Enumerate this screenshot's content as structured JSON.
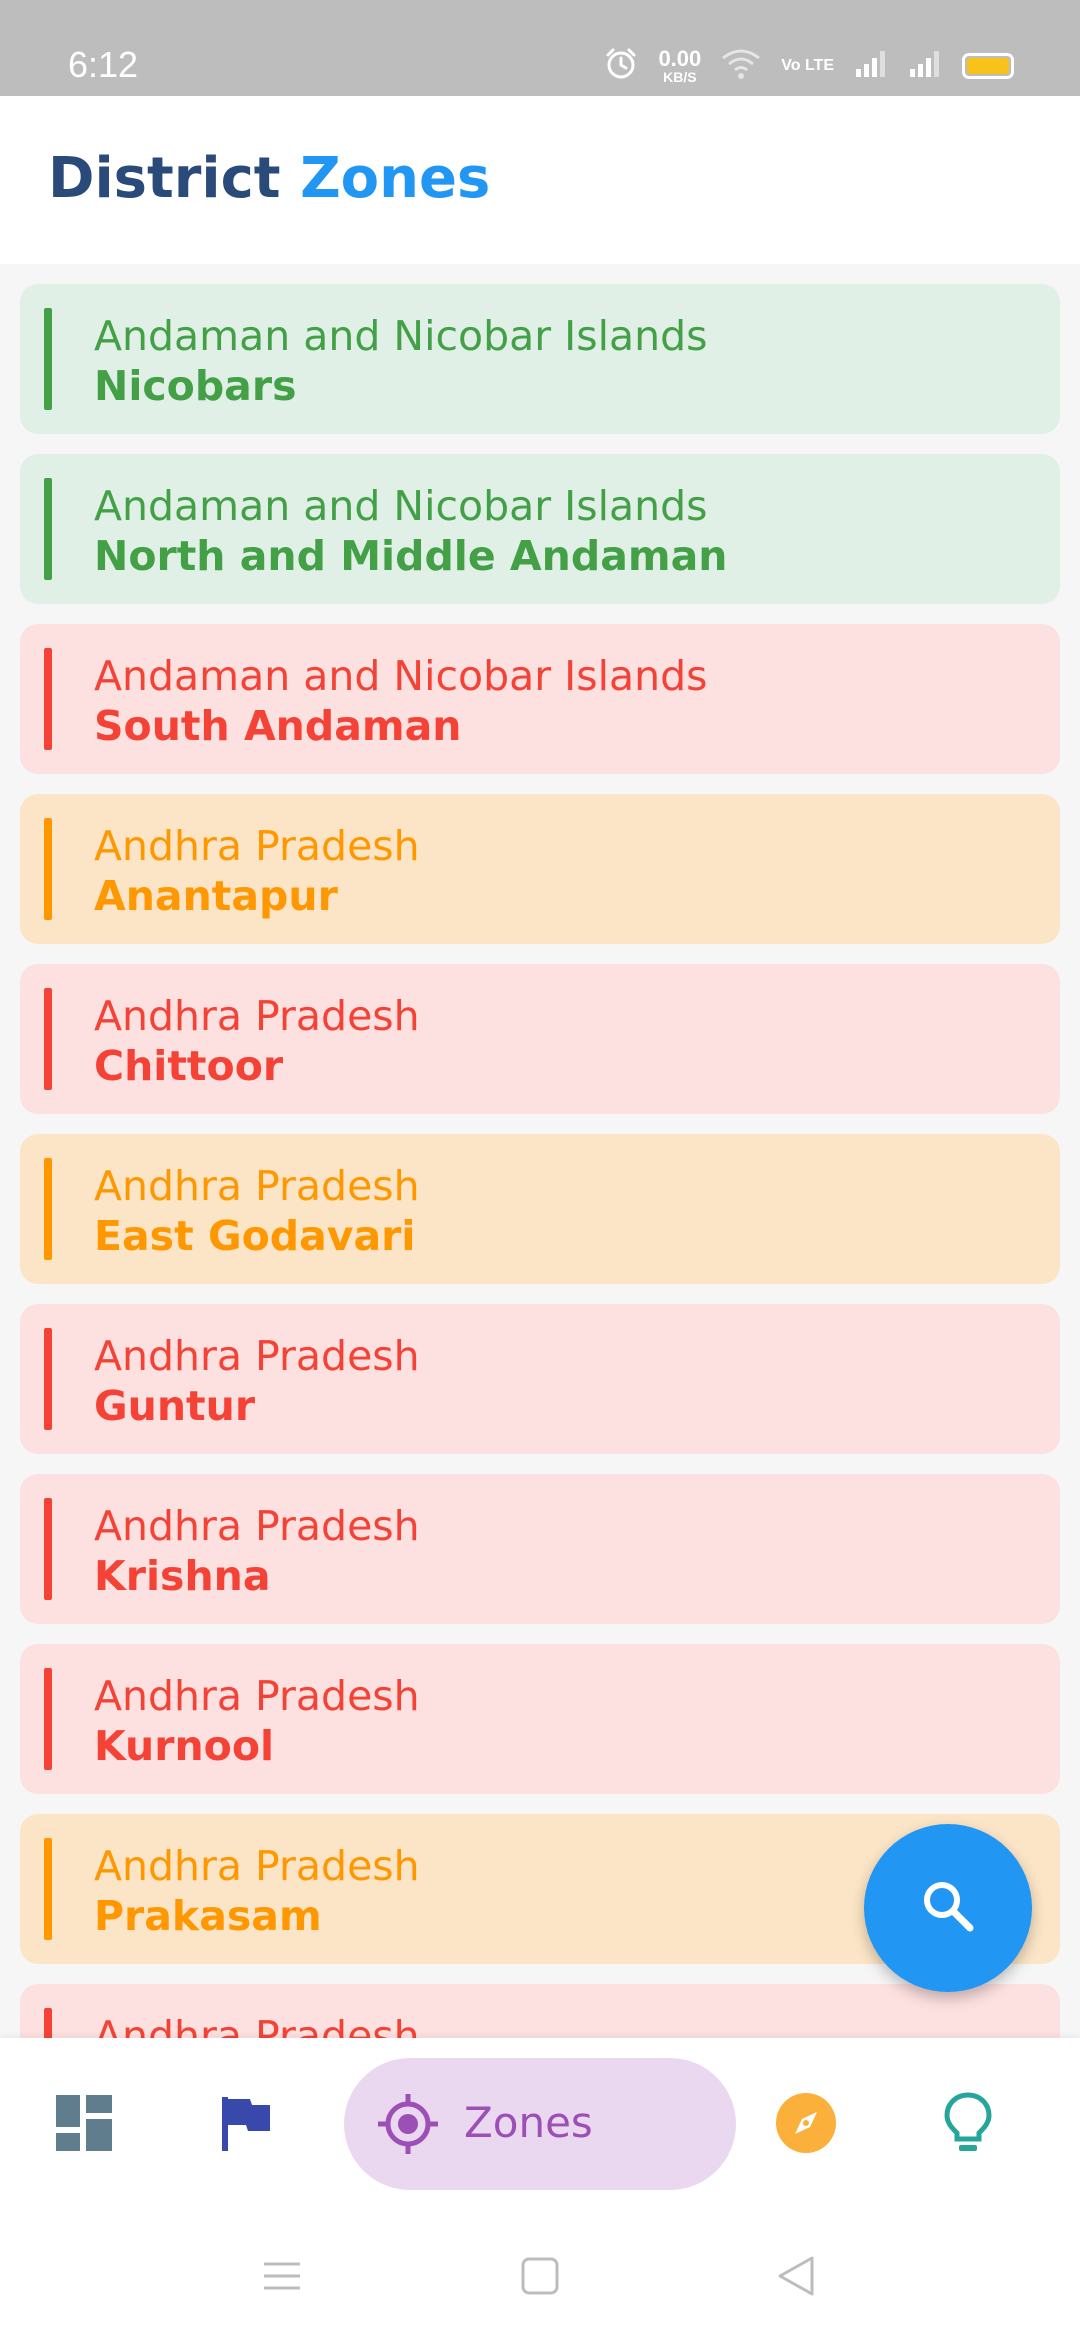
{
  "status_bar": {
    "time": "6:12",
    "net_speed_value": "0.00",
    "net_speed_unit": "KB/S",
    "volte_label": "Vo LTE",
    "icons": [
      "alarm-icon",
      "wifi-icon",
      "signal-icon",
      "signal-icon",
      "battery-icon"
    ],
    "battery_color": "#f7c31b"
  },
  "header": {
    "title_part1": "District",
    "title_part2": "Zones"
  },
  "colors": {
    "green_zone": "#43a047",
    "red_zone": "#f44336",
    "orange_zone": "#ff9800",
    "accent": "#2196f3"
  },
  "districts": [
    {
      "state": "Andaman and Nicobar Islands",
      "district": "Nicobars",
      "zone": "green"
    },
    {
      "state": "Andaman and Nicobar Islands",
      "district": "North and Middle Andaman",
      "zone": "green"
    },
    {
      "state": "Andaman and Nicobar Islands",
      "district": "South Andaman",
      "zone": "red"
    },
    {
      "state": "Andhra Pradesh",
      "district": "Anantapur",
      "zone": "orange"
    },
    {
      "state": "Andhra Pradesh",
      "district": "Chittoor",
      "zone": "red"
    },
    {
      "state": "Andhra Pradesh",
      "district": "East Godavari",
      "zone": "orange"
    },
    {
      "state": "Andhra Pradesh",
      "district": "Guntur",
      "zone": "red"
    },
    {
      "state": "Andhra Pradesh",
      "district": "Krishna",
      "zone": "red"
    },
    {
      "state": "Andhra Pradesh",
      "district": "Kurnool",
      "zone": "red"
    },
    {
      "state": "Andhra Pradesh",
      "district": "Prakasam",
      "zone": "orange"
    },
    {
      "state": "Andhra Pradesh",
      "district": "",
      "zone": "red"
    }
  ],
  "fab": {
    "icon": "search-icon"
  },
  "bottom_nav": {
    "items": [
      {
        "icon": "dashboard-icon"
      },
      {
        "icon": "flag-icon"
      },
      {
        "icon": "gps-target-icon",
        "label": "Zones",
        "active": true
      },
      {
        "icon": "compass-icon"
      },
      {
        "icon": "lightbulb-icon"
      }
    ]
  },
  "system_nav": {
    "icons": [
      "menu-icon",
      "home-square-icon",
      "back-triangle-icon"
    ]
  }
}
